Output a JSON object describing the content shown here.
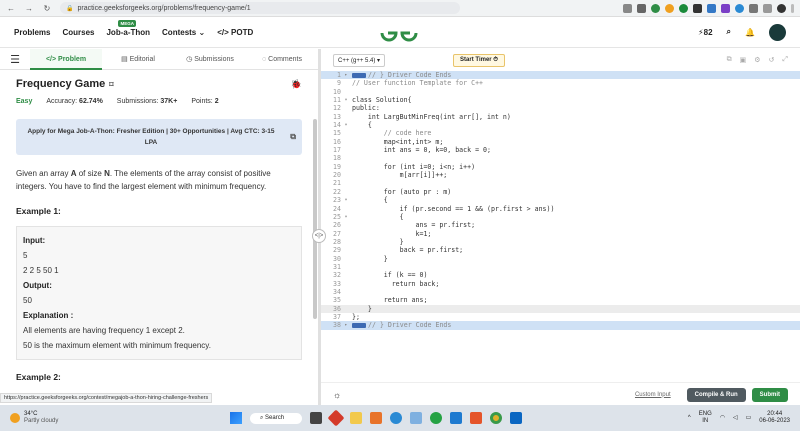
{
  "browser": {
    "url": "practice.geeksforgeeks.org/problems/frequency-game/1"
  },
  "header": {
    "nav": [
      "Problems",
      "Courses",
      "Job-a-Thon",
      "Contests",
      "POTD"
    ],
    "mega_badge": "MEGA",
    "contests_suffix": "⌄",
    "potd_prefix": "</>",
    "streak_count": "82"
  },
  "tabs": [
    "Problem",
    "Editorial",
    "Submissions",
    "Comments"
  ],
  "problem": {
    "title": "Frequency Game",
    "difficulty": "Easy",
    "accuracy_label": "Accuracy:",
    "accuracy": "62.74%",
    "submissions_label": "Submissions:",
    "submissions": "37K+",
    "points_label": "Points:",
    "points": "2",
    "banner": "Apply for Mega Job-A-Thon: Fresher Edition | 30+ Opportunities | Avg CTC: 3-15 LPA",
    "desc_1": "Given an array ",
    "desc_a": "A",
    "desc_2": " of size ",
    "desc_n": "N",
    "desc_3": ". The elements of the array consist of positive integers. You have to find the largest element with minimum frequency.",
    "example1_title": "Example 1:",
    "input_label": "Input:",
    "input_line1": "5",
    "input_line2": "2 2 5 50 1",
    "output_label": "Output:",
    "output_value": "50",
    "explanation_label": "Explanation :",
    "explanation_1": "All elements are having frequency 1 except 2.",
    "explanation_2": "50 is the maximum element with minimum frequency.",
    "example2_title": "Example 2:"
  },
  "status_url": "https://practice.geeksforgeeks.org/contest/megajob-a-thon-hiring-challenge-freshers",
  "editor": {
    "language": "C++ (g++ 5.4) ▾",
    "timer_label": "Start Timer",
    "lines": [
      {
        "n": "1",
        "f": "▸",
        "t": "// } Driver Code Ends",
        "cls": "hl cm",
        "badge": true
      },
      {
        "n": "9",
        "f": "",
        "t": "// User function Template for C++",
        "cls": "cm"
      },
      {
        "n": "10",
        "f": "",
        "t": "",
        "cls": ""
      },
      {
        "n": "11",
        "f": "▾",
        "t": "class Solution{",
        "cls": ""
      },
      {
        "n": "12",
        "f": "",
        "t": "public:",
        "cls": ""
      },
      {
        "n": "13",
        "f": "",
        "t": "    int LargButMinFreq(int arr[], int n)",
        "cls": ""
      },
      {
        "n": "14",
        "f": "▾",
        "t": "    {",
        "cls": ""
      },
      {
        "n": "15",
        "f": "",
        "t": "        // code here",
        "cls": "cm"
      },
      {
        "n": "16",
        "f": "",
        "t": "        map<int,int> m;",
        "cls": ""
      },
      {
        "n": "17",
        "f": "",
        "t": "        int ans = 0, k=0, back = 0;",
        "cls": ""
      },
      {
        "n": "18",
        "f": "",
        "t": "",
        "cls": ""
      },
      {
        "n": "19",
        "f": "",
        "t": "        for (int i=0; i<n; i++)",
        "cls": ""
      },
      {
        "n": "20",
        "f": "",
        "t": "            m[arr[i]]++;",
        "cls": ""
      },
      {
        "n": "21",
        "f": "",
        "t": "",
        "cls": ""
      },
      {
        "n": "22",
        "f": "",
        "t": "        for (auto pr : m)",
        "cls": ""
      },
      {
        "n": "23",
        "f": "▾",
        "t": "        {",
        "cls": ""
      },
      {
        "n": "24",
        "f": "",
        "t": "            if (pr.second == 1 && (pr.first > ans))",
        "cls": ""
      },
      {
        "n": "25",
        "f": "▾",
        "t": "            {",
        "cls": ""
      },
      {
        "n": "26",
        "f": "",
        "t": "                ans = pr.first;",
        "cls": ""
      },
      {
        "n": "27",
        "f": "",
        "t": "                k=1;",
        "cls": ""
      },
      {
        "n": "28",
        "f": "",
        "t": "            }",
        "cls": ""
      },
      {
        "n": "29",
        "f": "",
        "t": "            back = pr.first;",
        "cls": ""
      },
      {
        "n": "30",
        "f": "",
        "t": "        }",
        "cls": ""
      },
      {
        "n": "31",
        "f": "",
        "t": "",
        "cls": ""
      },
      {
        "n": "32",
        "f": "",
        "t": "        if (k == 0)",
        "cls": ""
      },
      {
        "n": "33",
        "f": "",
        "t": "          return back;",
        "cls": ""
      },
      {
        "n": "34",
        "f": "",
        "t": "",
        "cls": ""
      },
      {
        "n": "35",
        "f": "",
        "t": "        return ans;",
        "cls": ""
      },
      {
        "n": "36",
        "f": "",
        "t": "    }",
        "cls": "cur"
      },
      {
        "n": "37",
        "f": "",
        "t": "};",
        "cls": ""
      },
      {
        "n": "38",
        "f": "▸",
        "t": "// } Driver Code Ends",
        "cls": "hl cm",
        "badge": true
      }
    ],
    "custom_input": "Custom Input",
    "compile_run": "Compile & Run",
    "submit": "Submit"
  },
  "taskbar": {
    "temp": "34°C",
    "weather": "Partly cloudy",
    "search": "Search",
    "lang_1": "ENG",
    "lang_2": "IN",
    "time": "20:44",
    "date": "06-06-2023"
  },
  "colors": {
    "brand_green": "#2f8d46",
    "highlight": "#cfe1f5"
  }
}
